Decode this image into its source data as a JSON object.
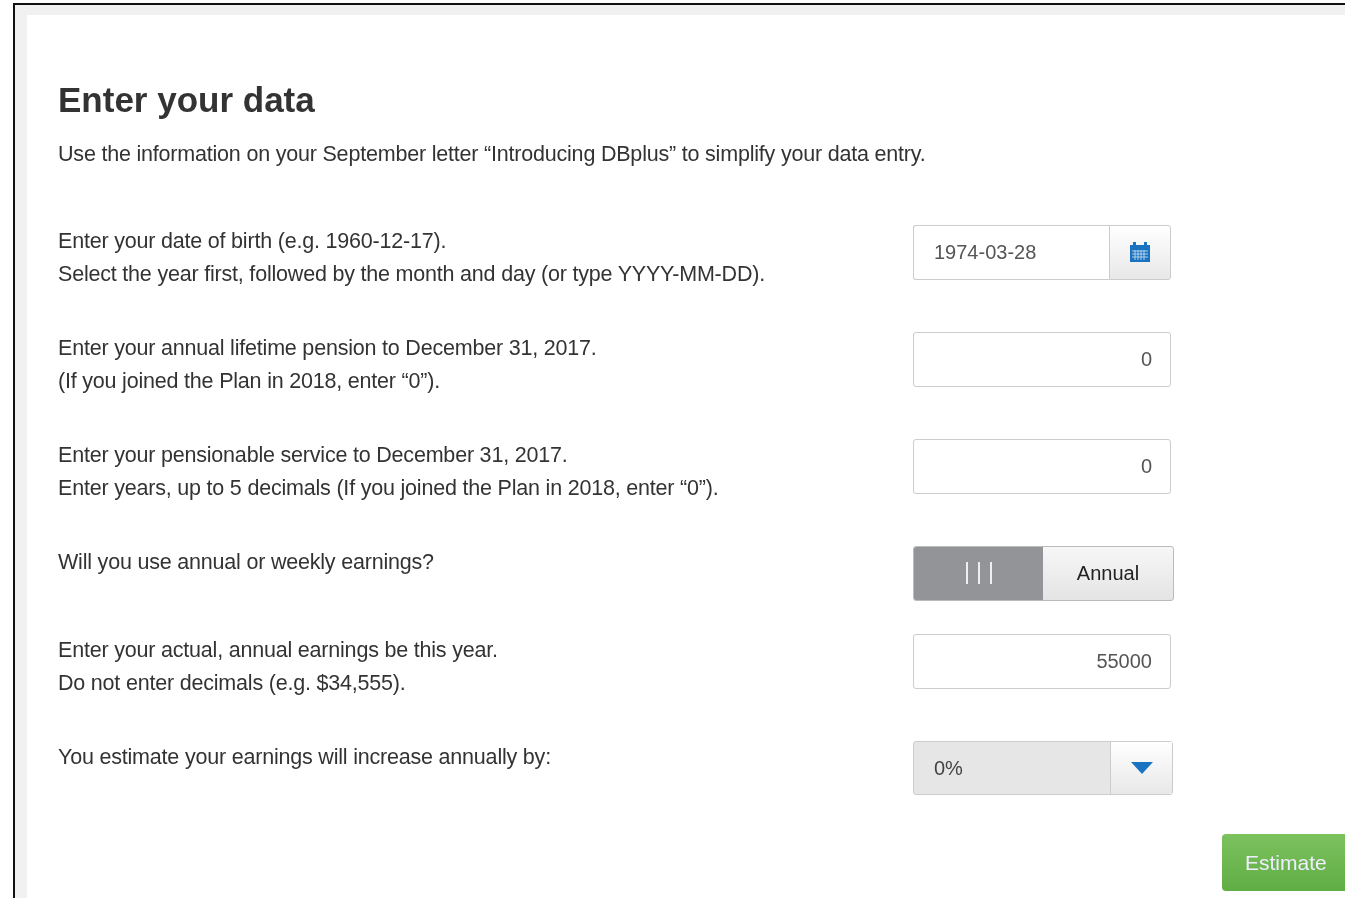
{
  "title": "Enter your data",
  "intro": "Use the information on your September letter “Introducing DBplus” to simplify your data entry.",
  "fields": [
    {
      "kind": "date",
      "lines": [
        "Enter your date of birth (e.g. 1960-12-17).",
        "Select the year first, followed by the month and day (or type YYYY-MM-DD)."
      ],
      "value": "1974-03-28"
    },
    {
      "kind": "number",
      "lines": [
        "Enter your annual lifetime pension to December 31, 2017.",
        "(If you joined the Plan in 2018, enter “0”)."
      ],
      "value": "0"
    },
    {
      "kind": "number",
      "lines": [
        "Enter your pensionable service to December 31, 2017.",
        "Enter years, up to 5 decimals (If you joined the Plan in 2018, enter “0”)."
      ],
      "value": "0"
    },
    {
      "kind": "toggle",
      "lines": [
        "Will you use annual or weekly earnings?"
      ],
      "label": "Annual",
      "on": false
    },
    {
      "kind": "number",
      "lines": [
        "Enter your actual, annual earnings be this year.",
        "Do not enter decimals (e.g. $34,555)."
      ],
      "value": "55000"
    },
    {
      "kind": "select",
      "lines": [
        "You estimate your earnings will increase annually by:"
      ],
      "value": "0%"
    }
  ],
  "estimate_button": "Estimate"
}
